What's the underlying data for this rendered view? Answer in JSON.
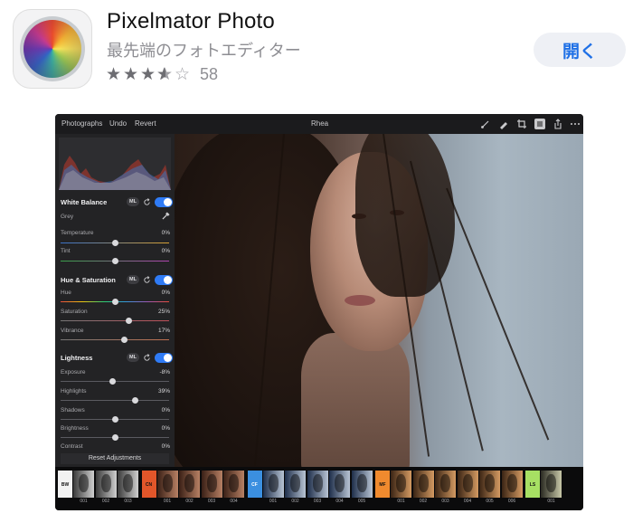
{
  "app": {
    "title": "Pixelmator Photo",
    "subtitle": "最先端のフォトエディター",
    "rating": 3.5,
    "rating_count": "58",
    "open_label": "開く",
    "accent_color": "#1f70e6"
  },
  "screenshot": {
    "toolbar": {
      "left": [
        "Photographs",
        "Undo",
        "Revert"
      ],
      "title": "Rhea",
      "icons": [
        "brush-icon",
        "pen-icon",
        "crop-icon",
        "adjust-icon",
        "share-icon",
        "more-icon"
      ]
    },
    "panel": {
      "white_balance": {
        "title": "White Balance",
        "ml": "ML",
        "rows": [
          {
            "label": "Grey",
            "value": ""
          },
          {
            "label": "Temperature",
            "value": "0%"
          },
          {
            "label": "Tint",
            "value": "0%"
          }
        ]
      },
      "hue_saturation": {
        "title": "Hue & Saturation",
        "ml": "ML",
        "rows": [
          {
            "label": "Hue",
            "value": "0%"
          },
          {
            "label": "Saturation",
            "value": "25%"
          },
          {
            "label": "Vibrance",
            "value": "17%"
          }
        ]
      },
      "lightness": {
        "title": "Lightness",
        "ml": "ML",
        "rows": [
          {
            "label": "Exposure",
            "value": "-8%"
          },
          {
            "label": "Highlights",
            "value": "39%"
          },
          {
            "label": "Shadows",
            "value": "0%"
          },
          {
            "label": "Brightness",
            "value": "0%"
          },
          {
            "label": "Contrast",
            "value": "0%"
          }
        ]
      },
      "reset_label": "Reset Adjustments"
    },
    "filmstrip": {
      "groups": [
        {
          "code": "BW",
          "color": "#f2f2f2",
          "text_color": "#111",
          "items": [
            "001",
            "002",
            "003"
          ]
        },
        {
          "code": "CN",
          "color": "#e2562a",
          "text_color": "#111",
          "items": [
            "001",
            "002",
            "003",
            "004"
          ]
        },
        {
          "code": "CF",
          "color": "#3b8fe0",
          "text_color": "#fff",
          "items": [
            "001",
            "002",
            "003",
            "004",
            "005"
          ]
        },
        {
          "code": "MF",
          "color": "#f08a2e",
          "text_color": "#111",
          "items": [
            "001",
            "002",
            "003",
            "004",
            "005",
            "006"
          ]
        },
        {
          "code": "LS",
          "color": "#a7e063",
          "text_color": "#111",
          "items": [
            "001"
          ]
        }
      ]
    }
  }
}
